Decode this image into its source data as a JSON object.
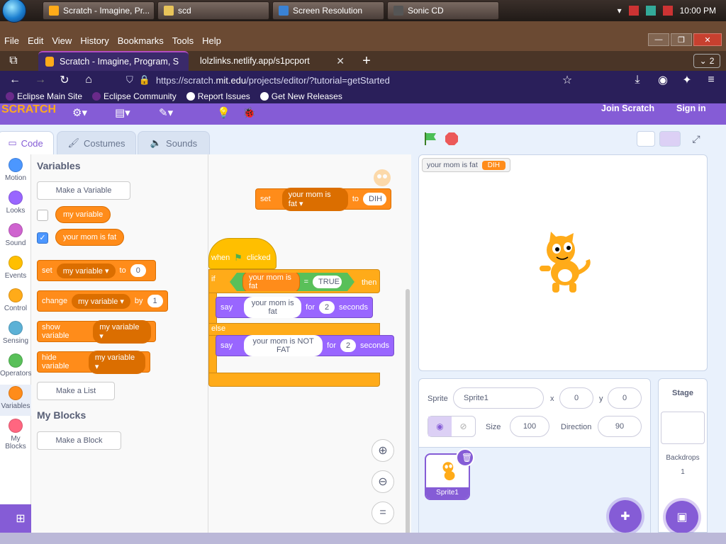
{
  "taskbar": {
    "buttons": [
      {
        "label": "Scratch - Imagine, Pr..."
      },
      {
        "label": "scd"
      },
      {
        "label": "Screen Resolution"
      },
      {
        "label": "Sonic CD"
      }
    ],
    "clock": "10:00 PM"
  },
  "menubar": [
    "File",
    "Edit",
    "View",
    "History",
    "Bookmarks",
    "Tools",
    "Help"
  ],
  "browser_tabs": [
    {
      "label": "Scratch - Imagine, Program, Sha"
    },
    {
      "label": "lolzlinks.netlify.app/s1pcport"
    }
  ],
  "tab_count": "2",
  "url": {
    "prefix": "https://scratch.",
    "host": "mit.edu",
    "rest": "/projects/editor/?tutorial=getStarted"
  },
  "bookmarks": [
    "Eclipse Main Site",
    "Eclipse Community",
    "Report Issues",
    "Get New Releases"
  ],
  "header": {
    "logo": "SCRATCH",
    "join": "Join Scratch",
    "signin": "Sign in"
  },
  "editor_tabs": [
    "Code",
    "Costumes",
    "Sounds"
  ],
  "categories": [
    {
      "label": "Motion",
      "color": "#4c97ff"
    },
    {
      "label": "Looks",
      "color": "#9966ff"
    },
    {
      "label": "Sound",
      "color": "#cf63cf"
    },
    {
      "label": "Events",
      "color": "#ffbf00"
    },
    {
      "label": "Control",
      "color": "#ffab19"
    },
    {
      "label": "Sensing",
      "color": "#5cb1d6"
    },
    {
      "label": "Operators",
      "color": "#59c059"
    },
    {
      "label": "Variables",
      "color": "#ff8c1a"
    },
    {
      "label": "My Blocks",
      "color": "#ff6680"
    }
  ],
  "palette": {
    "variables_heading": "Variables",
    "make_variable": "Make a Variable",
    "var1": "my variable",
    "var2": "your mom is fat",
    "set_block": {
      "verb": "set",
      "var": "my variable",
      "to": "to",
      "value": "0"
    },
    "change_block": {
      "verb": "change",
      "var": "my variable",
      "by": "by",
      "value": "1"
    },
    "show_block": {
      "verb": "show variable",
      "var": "my variable"
    },
    "hide_block": {
      "verb": "hide variable",
      "var": "my variable"
    },
    "make_list": "Make a List",
    "myblocks_heading": "My Blocks",
    "make_block": "Make a Block"
  },
  "script": {
    "set_block": {
      "verb": "set",
      "var": "your mom is fat",
      "to": "to",
      "value": "DIH"
    },
    "hat": {
      "when": "when",
      "clicked": "clicked"
    },
    "if_block": {
      "if": "if",
      "var": "your mom is fat",
      "eq": "=",
      "value": "TRUE",
      "then": "then"
    },
    "say1": {
      "verb": "say",
      "text": "your mom is fat",
      "for": "for",
      "secs": "2",
      "unit": "seconds"
    },
    "else": "else",
    "say2": {
      "verb": "say",
      "text": "your mom is NOT FAT",
      "for": "for",
      "secs": "2",
      "unit": "seconds"
    }
  },
  "monitor": {
    "name": "your mom is fat",
    "value": "DIH"
  },
  "sprite_info": {
    "sprite_label": "Sprite",
    "sprite_name": "Sprite1",
    "x_label": "x",
    "x": "0",
    "y_label": "y",
    "y": "0",
    "size_label": "Size",
    "size": "100",
    "direction_label": "Direction",
    "direction": "90"
  },
  "sprite_thumb_name": "Sprite1",
  "stage_panel": {
    "title": "Stage",
    "backdrops_label": "Backdrops",
    "backdrops_count": "1"
  },
  "colors": {
    "accent": "#855cd6",
    "variables": "#ff8c1a",
    "control": "#ffab19",
    "looks": "#9966ff"
  }
}
